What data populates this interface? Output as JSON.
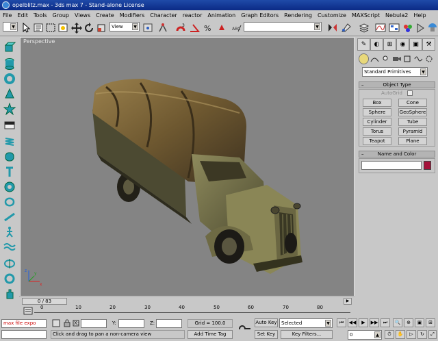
{
  "window": {
    "title": "opelblitz.max - 3ds max 7 - Stand-alone License"
  },
  "menu": [
    "File",
    "Edit",
    "Tools",
    "Group",
    "Views",
    "Create",
    "Modifiers",
    "Character",
    "reactor",
    "Animation",
    "Graph Editors",
    "Rendering",
    "Customize",
    "MAXScript",
    "Nebula2",
    "Help"
  ],
  "toolbar": {
    "selection_filter": "All",
    "view_coord": "View",
    "named_selection": ""
  },
  "viewport": {
    "label": "Perspective"
  },
  "command_panel": {
    "category": "Standard Primitives",
    "object_type_title": "Object Type",
    "autogrid_label": "AutoGrid",
    "buttons": [
      "Box",
      "Cone",
      "Sphere",
      "GeoSphere",
      "Cylinder",
      "Tube",
      "Torus",
      "Pyramid",
      "Teapot",
      "Plane"
    ],
    "name_color_title": "Name and Color",
    "name_value": "",
    "object_color": "#a5123a"
  },
  "timeline": {
    "frame_display": "0 / 83",
    "ticks": [
      "0",
      "10",
      "20",
      "30",
      "40",
      "50",
      "60",
      "70",
      "80"
    ]
  },
  "status": {
    "script_listener": "max file expo",
    "x_label": "X:",
    "y_label": "Y:",
    "z_label": "Z:",
    "x_value": "",
    "y_value": "",
    "z_value": "",
    "grid": "Grid = 100.0",
    "prompt": "Click and drag to pan a non-camera view",
    "add_time_tag": "Add Time Tag",
    "auto_key": "Auto Key",
    "set_key": "Set Key",
    "key_mode": "Selected",
    "key_filters": "Key Filters...",
    "current_frame": "0"
  }
}
